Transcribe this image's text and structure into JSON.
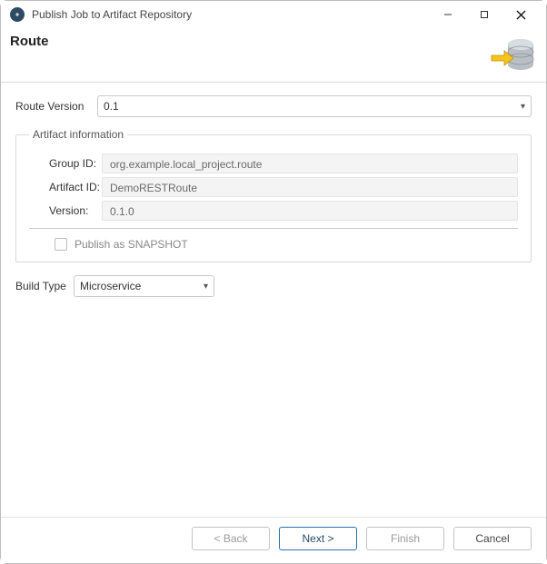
{
  "window": {
    "title": "Publish Job to Artifact Repository"
  },
  "header": {
    "title": "Route"
  },
  "routeVersion": {
    "label": "Route Version",
    "value": "0.1"
  },
  "artifact": {
    "legend": "Artifact information",
    "groupId": {
      "label": "Group ID:",
      "value": "org.example.local_project.route"
    },
    "artifactId": {
      "label": "Artifact ID:",
      "value": "DemoRESTRoute"
    },
    "version": {
      "label": "Version:",
      "value": "0.1.0"
    },
    "snapshot": {
      "label": "Publish as SNAPSHOT",
      "checked": false
    }
  },
  "buildType": {
    "label": "Build Type",
    "value": "Microservice"
  },
  "buttons": {
    "back": "< Back",
    "next": "Next >",
    "finish": "Finish",
    "cancel": "Cancel"
  }
}
